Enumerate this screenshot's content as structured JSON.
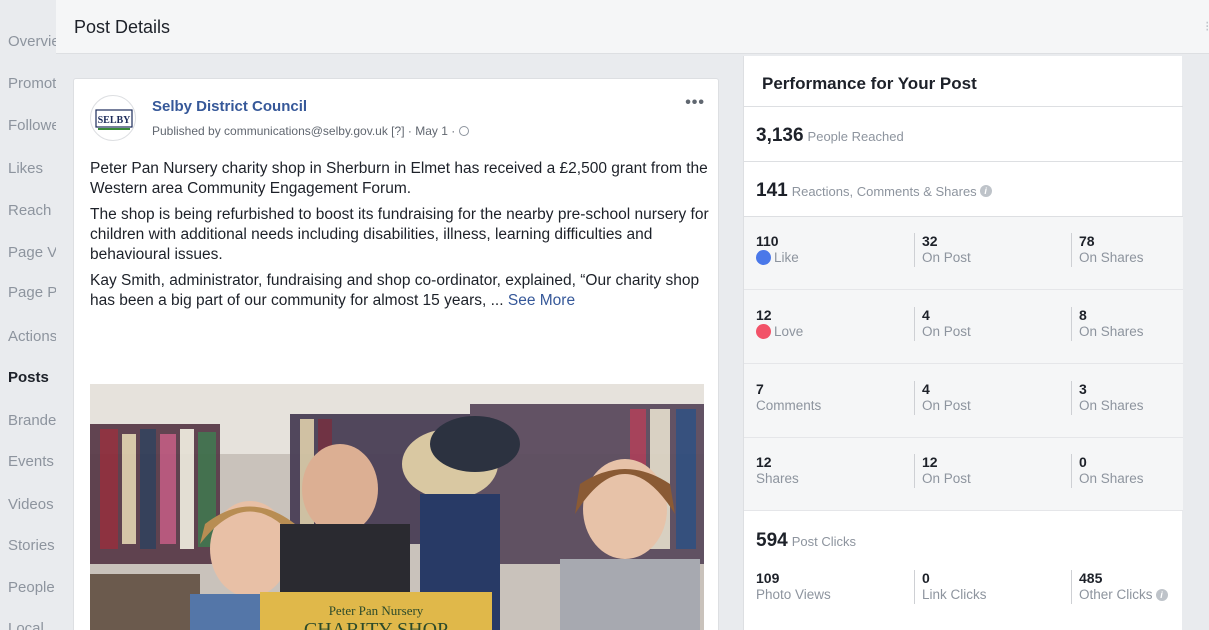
{
  "sidebar": {
    "items": [
      {
        "label": "Overview"
      },
      {
        "label": "Promotions"
      },
      {
        "label": "Followers"
      },
      {
        "label": "Likes"
      },
      {
        "label": "Reach"
      },
      {
        "label": "Page Views"
      },
      {
        "label": "Page Previews"
      },
      {
        "label": "Actions on Page"
      },
      {
        "label": "Posts"
      },
      {
        "label": "Branded Content"
      },
      {
        "label": "Events"
      },
      {
        "label": "Videos"
      },
      {
        "label": "Stories"
      },
      {
        "label": "People"
      },
      {
        "label": "Local"
      }
    ]
  },
  "header": {
    "title": "Post Details"
  },
  "post": {
    "author": "Selby District Council",
    "meta": "Published by communications@selby.gov.uk [?] · May 1 · ",
    "avatar_text": "SELBY",
    "paragraphs": [
      "Peter Pan Nursery charity shop in Sherburn in Elmet has received a £2,500 grant from the Western area Community Engagement Forum.",
      "The shop is being refurbished to boost its fundraising for the nearby pre-school nursery for children with additional needs including disabilities, illness, learning difficulties and behavioural issues.",
      "Kay Smith, administrator, fundraising and shop co-ordinator, explained, “Our charity shop has been a big part of our community for almost 15 years, ..."
    ],
    "see_more": "See More",
    "image_sign_line1": "Peter Pan Nursery",
    "image_sign_line2": "CHARITY SHOP"
  },
  "performance": {
    "title": "Performance for Your Post",
    "reached": {
      "value": "3,136",
      "label": "People Reached"
    },
    "engagement": {
      "value": "141",
      "label": "Reactions, Comments & Shares"
    },
    "rows": [
      {
        "v1": "110",
        "l1": "Like",
        "v2": "32",
        "l2": "On Post",
        "v3": "78",
        "l3": "On Shares"
      },
      {
        "v1": "12",
        "l1": "Love",
        "v2": "4",
        "l2": "On Post",
        "v3": "8",
        "l3": "On Shares"
      },
      {
        "v1": "7",
        "l1": "Comments",
        "v2": "4",
        "l2": "On Post",
        "v3": "3",
        "l3": "On Shares"
      },
      {
        "v1": "12",
        "l1": "Shares",
        "v2": "12",
        "l2": "On Post",
        "v3": "0",
        "l3": "On Shares"
      }
    ],
    "clicks": {
      "value": "594",
      "label": "Post Clicks"
    },
    "click_breakdown": {
      "v1": "109",
      "l1": "Photo Views",
      "v2": "0",
      "l2": "Link Clicks",
      "v3": "485",
      "l3": "Other Clicks"
    }
  },
  "colors": {
    "link": "#365899",
    "like": "#4a78e9",
    "love": "#f25268",
    "muted": "#8d949e"
  }
}
